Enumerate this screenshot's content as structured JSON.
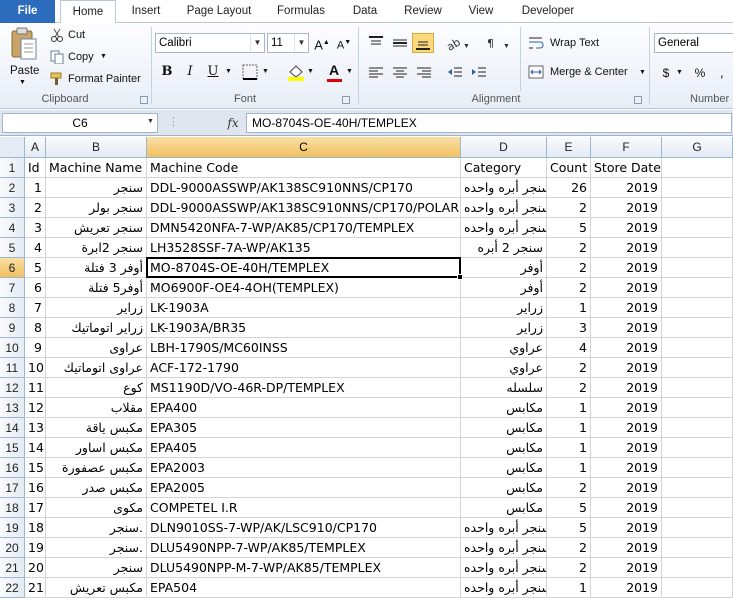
{
  "ribbon_tabs": [
    "File",
    "Home",
    "Insert",
    "Page Layout",
    "Formulas",
    "Data",
    "Review",
    "View",
    "Developer"
  ],
  "clipboard": {
    "paste": "Paste",
    "cut": "Cut",
    "copy": "Copy",
    "format_painter": "Format Painter",
    "group": "Clipboard"
  },
  "font": {
    "name": "Calibri",
    "size": "11",
    "group": "Font",
    "bold": "B",
    "italic": "I",
    "underline": "U"
  },
  "alignment": {
    "wrap_text": "Wrap Text",
    "merge_center": "Merge & Center",
    "group": "Alignment"
  },
  "number": {
    "format": "General",
    "currency": "$",
    "percent": "%",
    "group": "Number"
  },
  "formula_bar": {
    "name_box": "C6",
    "fx": "fx",
    "content": "MO-8704S-OE-40H/TEMPLEX"
  },
  "columns": [
    "A",
    "B",
    "C",
    "D",
    "E",
    "F",
    "G"
  ],
  "headers": [
    "Id",
    "Machine Name",
    "Machine Code",
    "Category",
    "Count",
    "Store Date"
  ],
  "rows": [
    [
      "1",
      "سنجر",
      "DDL-9000ASSWP/AK138SC910NNS/CP170",
      "سنجر أبره واحده",
      "26",
      "2019"
    ],
    [
      "2",
      "سنجر بولر",
      "DDL-9000ASSWP/AK138SC910NNS/CP170/POLAR",
      "سنجر أبره واحده",
      "2",
      "2019"
    ],
    [
      "3",
      "سنجر تعريش",
      "DMN5420NFA-7-WP/AK85/CP170/TEMPLEX",
      "سنجر أبره واحده",
      "5",
      "2019"
    ],
    [
      "4",
      "سنجر 2ابرة",
      "LH3528SSF-7A-WP/AK135",
      "سنجر 2 أبره",
      "2",
      "2019"
    ],
    [
      "5",
      "أوفر 3 فتلة",
      "MO-8704S-OE-40H/TEMPLEX",
      "أوفر",
      "2",
      "2019"
    ],
    [
      "6",
      "أوفر5 فتلة",
      "MO6900F-OE4-4OH(TEMPLEX)",
      "أوفر",
      "2",
      "2019"
    ],
    [
      "7",
      "زراير",
      "LK-1903A",
      "زراير",
      "1",
      "2019"
    ],
    [
      "8",
      "زراير اتوماتيك",
      "LK-1903A/BR35",
      "زراير",
      "3",
      "2019"
    ],
    [
      "9",
      "عراوى",
      "LBH-1790S/MC60INSS",
      "عراوي",
      "4",
      "2019"
    ],
    [
      "10",
      "عراوى اتوماتيك",
      "ACF-172-1790",
      "عراوي",
      "2",
      "2019"
    ],
    [
      "11",
      "كوع",
      "MS1190D/VO-46R-DP/TEMPLEX",
      "سلسله",
      "2",
      "2019"
    ],
    [
      "12",
      "مقلاب",
      "EPA400",
      "مكابس",
      "1",
      "2019"
    ],
    [
      "13",
      "مكبس ياقة",
      "EPA305",
      "مكابس",
      "1",
      "2019"
    ],
    [
      "14",
      "مكبس اساور",
      "EPA405",
      "مكابس",
      "1",
      "2019"
    ],
    [
      "15",
      "مكبس عصفورة",
      "EPA2003",
      "مكابس",
      "1",
      "2019"
    ],
    [
      "16",
      "مكبس صدر",
      "EPA2005",
      "مكابس",
      "2",
      "2019"
    ],
    [
      "17",
      "مكوى",
      "COMPETEL I.R",
      "مكابس",
      "5",
      "2019"
    ],
    [
      "18",
      "سنجر.",
      "DLN9010SS-7-WP/AK/LSC910/CP170",
      "سنجر أبره واحده",
      "5",
      "2019"
    ],
    [
      "19",
      "سنجر.",
      "DLU5490NPP-7-WP/AK85/TEMPLEX",
      "سنجر أبره واحده",
      "2",
      "2019"
    ],
    [
      "20",
      "سنجر",
      "DLU5490NPP-M-7-WP/AK85/TEMPLEX",
      "سنجر أبره واحده",
      "2",
      "2019"
    ],
    [
      "21",
      "مكبس تعريش",
      "EPA504",
      "سنجر أبره واحده",
      "1",
      "2019"
    ]
  ],
  "row_numbers": [
    "1",
    "2",
    "3",
    "4",
    "5",
    "6",
    "7",
    "8",
    "9",
    "10",
    "11",
    "12",
    "13",
    "14",
    "15",
    "16",
    "17",
    "18",
    "19",
    "20",
    "21",
    "22"
  ],
  "active_cell": "C6",
  "colors": {
    "file_tab": "#2c6cbd",
    "header_selected": "#f1c15f",
    "gridline": "#d4d4d4"
  }
}
